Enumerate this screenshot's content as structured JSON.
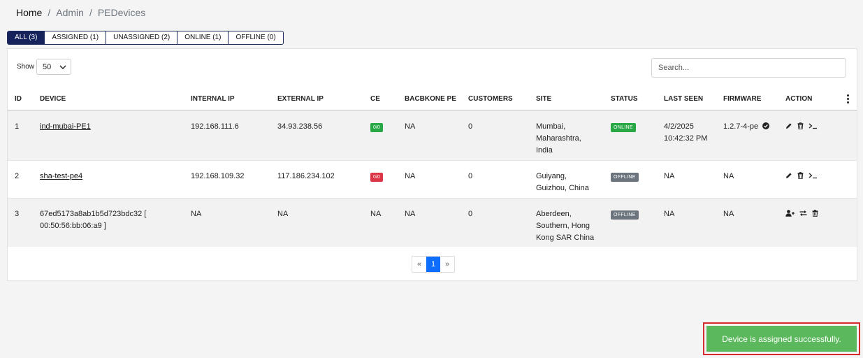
{
  "breadcrumb": {
    "home": "Home",
    "admin": "Admin",
    "current": "PEDevices",
    "sep": "/"
  },
  "tabs": [
    {
      "label": "ALL (3)"
    },
    {
      "label": "ASSIGNED (1)"
    },
    {
      "label": "UNASSIGNED (2)"
    },
    {
      "label": "ONLINE (1)"
    },
    {
      "label": "OFFLINE (0)"
    }
  ],
  "show": {
    "label": "Show",
    "value": "50"
  },
  "search": {
    "placeholder": "Search..."
  },
  "columns": {
    "id": "ID",
    "device": "DEVICE",
    "internal_ip": "INTERNAL IP",
    "external_ip": "EXTERNAL IP",
    "ce": "CE",
    "backbone_pe": "BACBKONE PE",
    "customers": "CUSTOMERS",
    "site": "SITE",
    "status": "STATUS",
    "last_seen": "LAST SEEN",
    "firmware": "FIRMWARE",
    "action": "ACTION"
  },
  "rows": [
    {
      "id": "1",
      "device": "ind-mubai-PE1",
      "internal_ip": "192.168.111.6",
      "external_ip": "34.93.238.56",
      "ce": "0/0",
      "backbone_pe": "NA",
      "customers": "0",
      "site_l1": "Mumbai,",
      "site_l2": "Maharashtra,",
      "site_l3": "India",
      "status": "ONLINE",
      "last_seen_l1": "4/2/2025",
      "last_seen_l2": "10:42:32 PM",
      "firmware": "1.2.7-4-pe"
    },
    {
      "id": "2",
      "device": "sha-test-pe4",
      "internal_ip": "192.168.109.32",
      "external_ip": "117.186.234.102",
      "ce": "0/0",
      "backbone_pe": "NA",
      "customers": "0",
      "site_l1": "Guiyang,",
      "site_l2": "Guizhou, China",
      "status": "OFFLINE",
      "last_seen": "NA",
      "firmware": "NA"
    },
    {
      "id": "3",
      "device_l1": "67ed5173a8ab1b5d723bdc32 [",
      "device_l2": "00:50:56:bb:06:a9 ]",
      "internal_ip": "NA",
      "external_ip": "NA",
      "ce": "NA",
      "backbone_pe": "NA",
      "customers": "0",
      "site_l1": "Aberdeen,",
      "site_l2": "Southern, Hong",
      "site_l3": "Kong SAR China",
      "status": "OFFLINE",
      "last_seen": "NA",
      "firmware": "NA"
    }
  ],
  "pagination": {
    "prev": "«",
    "current": "1",
    "next": "»"
  },
  "toast": {
    "message": "Device is assigned successfully."
  },
  "colors": {
    "tab_active": "#15225c",
    "ce_ok": "#28a745",
    "ce_bad": "#dc3545",
    "status_online": "#28a745",
    "status_offline": "#6c757d",
    "page_active": "#0d6efd",
    "toast_bg": "#5cb85c"
  }
}
